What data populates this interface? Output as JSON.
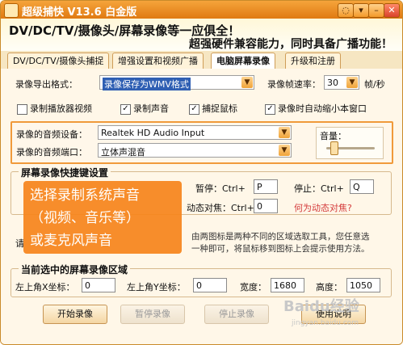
{
  "window": {
    "title": "超级捕快 V13.6 白金版",
    "controls": [
      "◌",
      "▾",
      "–",
      "✕"
    ]
  },
  "banner": {
    "line1": "DV/DC/TV/摄像头/屏幕录像等一应俱全！",
    "line2": "超强硬件兼容能力，同时具备广播功能！"
  },
  "tabs": [
    {
      "label": "DV/DC/TV/摄像头捕捉"
    },
    {
      "label": "增强设置和视频广播"
    },
    {
      "label": "电脑屏幕录像"
    },
    {
      "label": "升级和注册"
    }
  ],
  "export": {
    "format_label": "录像导出格式：",
    "format_value": "录像保存为WMV格式",
    "fps_label": "录像帧速率：",
    "fps_value": "30",
    "fps_unit": "帧/秒"
  },
  "checkboxes": [
    {
      "label": "录制播放器视频",
      "checked": false
    },
    {
      "label": "录制声音",
      "checked": true
    },
    {
      "label": "捕捉鼠标",
      "checked": true
    },
    {
      "label": "录像时自动缩小本窗口",
      "checked": true
    }
  ],
  "audio": {
    "device_label": "录像的音频设备：",
    "device_value": "Realtek HD Audio Input",
    "port_label": "录像的音频端口：",
    "port_value": "立体声混音",
    "volume_label": "音量：",
    "volume_level": 0.15
  },
  "hotkeys": {
    "title": "屏幕录像快捷键设置",
    "pause_label": "暂停：Ctrl+",
    "pause_key": "P",
    "stop_label": "停止：Ctrl+",
    "stop_key": "Q",
    "dynamic_label": "动态对焦：Ctrl+",
    "dynamic_key": "0",
    "dynamic_link": "何为动态对焦?"
  },
  "info": {
    "left": "请",
    "right_line1": "由两图标是两种不同的区域选取工具，您任意选",
    "right_line2": "一种即可，将鼠标移到图标上会提示使用方法。"
  },
  "region": {
    "title": "当前选中的屏幕录像区域",
    "x_label": "左上角X坐标：",
    "x_value": "0",
    "y_label": "左上角Y坐标：",
    "y_value": "0",
    "w_label": "宽度：",
    "w_value": "1680",
    "h_label": "高度：",
    "h_value": "1050"
  },
  "buttons": {
    "start": "开始录像",
    "pause": "暂停录像",
    "stop": "停止录像",
    "help": "使用说明"
  },
  "overlay": {
    "line1": "选择录制系统声音",
    "line2": "（视频、音乐等）",
    "line3": "或麦克风声音"
  },
  "watermark": {
    "main": "Baidu经验",
    "sub": "jingyan.baidu.com"
  }
}
